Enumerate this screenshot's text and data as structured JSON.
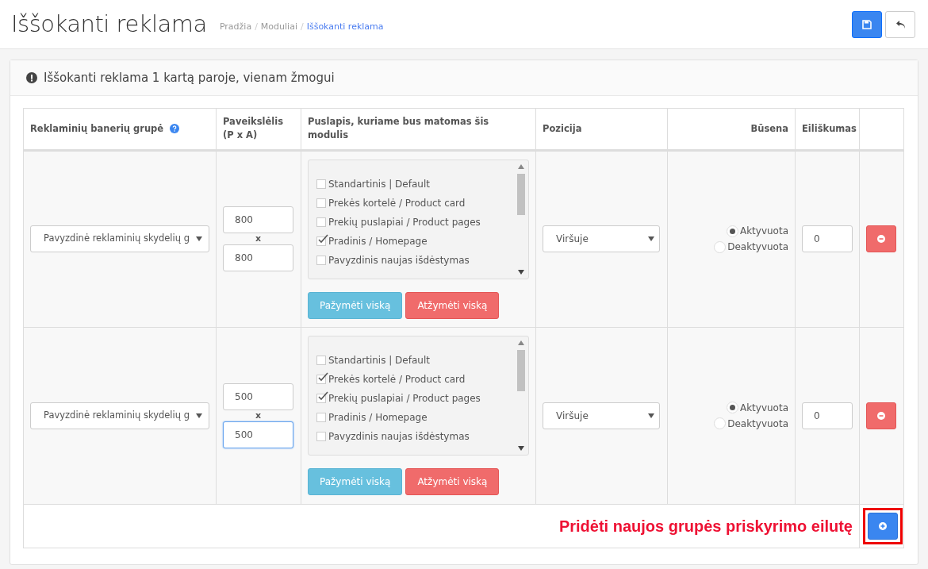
{
  "page": {
    "title": "Iššokanti reklama",
    "breadcrumb_separator": "/",
    "breadcrumb": [
      {
        "label": "Pradžia",
        "current": false
      },
      {
        "label": "Moduliai",
        "current": false
      },
      {
        "label": "Iššokanti reklama",
        "current": true
      }
    ]
  },
  "panel": {
    "title": "Iššokanti reklama 1 kartą paroje, vienam žmogui"
  },
  "table": {
    "columns": [
      "Reklaminių banerių grupė",
      "Paveikslėlis (P x A)",
      "Puslapis, kuriame bus matomas šis modulis",
      "Pozicija",
      "Būsena",
      "Eiliškumas"
    ],
    "rows": [
      {
        "group": "Pavyzdinė reklaminių skydelių g",
        "width": {
          "value": "800",
          "focused": false
        },
        "separator": "x",
        "height": {
          "value": "800",
          "focused": false
        },
        "pages": [
          {
            "label": "Standartinis | Default",
            "checked": false
          },
          {
            "label": "Prekės kortelė / Product card",
            "checked": false
          },
          {
            "label": "Prekių puslapiai / Product pages",
            "checked": false
          },
          {
            "label": "Pradinis / Homepage",
            "checked": true
          },
          {
            "label": "Pavyzdinis naujas išdėstymas",
            "checked": false
          }
        ],
        "select_all": "Pažymėti viską",
        "deselect_all": "Atžymėti viską",
        "position": "Viršuje",
        "status": [
          {
            "label": "Aktyvuota",
            "selected": true
          },
          {
            "label": "Deaktyvuota",
            "selected": false
          }
        ],
        "order": "0"
      },
      {
        "group": "Pavyzdinė reklaminių skydelių g",
        "width": {
          "value": "500",
          "focused": false
        },
        "separator": "x",
        "height": {
          "value": "500",
          "focused": true
        },
        "pages": [
          {
            "label": "Standartinis | Default",
            "checked": false
          },
          {
            "label": "Prekės kortelė / Product card",
            "checked": true
          },
          {
            "label": "Prekių puslapiai / Product pages",
            "checked": true
          },
          {
            "label": "Pradinis / Homepage",
            "checked": false
          },
          {
            "label": "Pavyzdinis naujas išdėstymas",
            "checked": false
          }
        ],
        "select_all": "Pažymėti viską",
        "deselect_all": "Atžymėti viską",
        "position": "Viršuje",
        "status": [
          {
            "label": "Aktyvuota",
            "selected": true
          },
          {
            "label": "Deaktyvuota",
            "selected": false
          }
        ],
        "order": "0"
      }
    ],
    "add_row_label": "Pridėti naujos grupės priskyrimo eilutę"
  }
}
